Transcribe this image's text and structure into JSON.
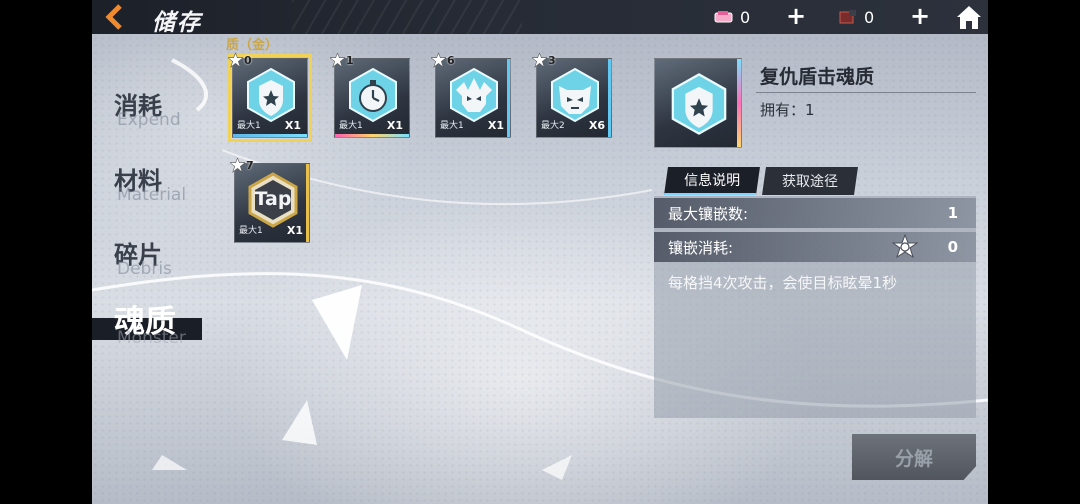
{
  "topbar": {
    "title": "储存",
    "resource_1": {
      "icon": "pink-ticket-icon",
      "value": "0"
    },
    "resource_2": {
      "icon": "red-crate-icon",
      "value": "0"
    },
    "plus_label": "+"
  },
  "sidebar": {
    "tabs": [
      {
        "cn": "消耗",
        "en": "Expend",
        "active": false
      },
      {
        "cn": "材料",
        "en": "Material",
        "active": false
      },
      {
        "cn": "碎片",
        "en": "Debris",
        "active": false
      },
      {
        "cn": "魂质",
        "en": "Monster",
        "active": true
      }
    ]
  },
  "section_label": "质（金）",
  "items": [
    {
      "stars": "0",
      "max": "最大1",
      "count": "X1",
      "icon": "shield-star-icon",
      "selected": true
    },
    {
      "stars": "1",
      "max": "最大1",
      "count": "X1",
      "icon": "stopwatch-icon",
      "selected": false
    },
    {
      "stars": "6",
      "max": "最大1",
      "count": "X1",
      "icon": "skull-crest-icon",
      "selected": false
    },
    {
      "stars": "3",
      "max": "最大2",
      "count": "X6",
      "icon": "beast-head-icon",
      "selected": false
    },
    {
      "stars": "7",
      "max": "最大1",
      "count": "X1",
      "icon": "tap-hexagon-icon",
      "selected": false,
      "art_text": "Tap"
    }
  ],
  "detail": {
    "name": "复仇盾击魂质",
    "owned": "拥有：1",
    "tabs": {
      "info": "信息说明",
      "source": "获取途径"
    },
    "max_inlay_label": "最大镶嵌数:",
    "max_inlay_value": "1",
    "inlay_cost_label": "镶嵌消耗:",
    "inlay_cost_value": "0",
    "description": "每格挡4次攻击，会使目标眩晕1秒",
    "decompose_label": "分解"
  },
  "colors": {
    "accent_gold": "#f1d258",
    "accent_blue": "#61c8f3",
    "dark_bar": "#1b1f27"
  }
}
